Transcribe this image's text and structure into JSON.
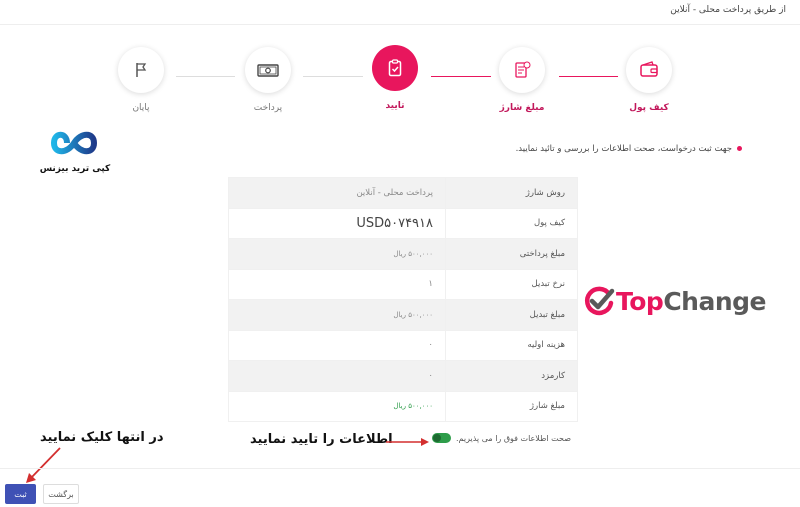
{
  "header": {
    "title": "از طریق پرداخت محلی - آنلاین"
  },
  "stepper": {
    "steps": [
      {
        "label": "کیف پول",
        "icon": "wallet-icon"
      },
      {
        "label": "مبلغ شارژ",
        "icon": "invoice-icon"
      },
      {
        "label": "تایید",
        "icon": "clipboard-check-icon"
      },
      {
        "label": "پرداخت",
        "icon": "banknote-icon"
      },
      {
        "label": "پایان",
        "icon": "flag-icon"
      }
    ],
    "active_index": 2,
    "accent_color": "#e8165d"
  },
  "note": "جهت ثبت درخواست، صحت اطلاعات را بررسی و تائید نمایید.",
  "details": {
    "rows": [
      {
        "key": "روش شارژ",
        "value": "پرداخت محلی - آنلاین"
      },
      {
        "key": "کیف پول",
        "value": "USD۵۰۷۴۹۱۸"
      },
      {
        "key": "مبلغ پرداختی",
        "value": "۵۰۰,۰۰۰ ریال"
      },
      {
        "key": "نرخ تبدیل",
        "value": "۱"
      },
      {
        "key": "مبلغ تبدیل",
        "value": "۵۰۰,۰۰۰ ریال"
      },
      {
        "key": "هزینه اولیه",
        "value": "۰"
      },
      {
        "key": "کارمزد",
        "value": "۰"
      },
      {
        "key": "مبلغ شارژ",
        "value": "۵۰۰,۰۰۰ ریال"
      }
    ]
  },
  "consent": {
    "label": "صحت اطلاعات فوق را می پذیریم.",
    "checked": true
  },
  "buttons": {
    "submit": "ثبت",
    "back": "برگشت"
  },
  "annotations": {
    "click_end": "در انتها کلیک نمایید",
    "confirm_info": "اطلاعات را تایید نمایید"
  },
  "logos": {
    "left_name": "کپی ترید بیزنس",
    "topchange_part1": "Top",
    "topchange_part2": "Change"
  }
}
